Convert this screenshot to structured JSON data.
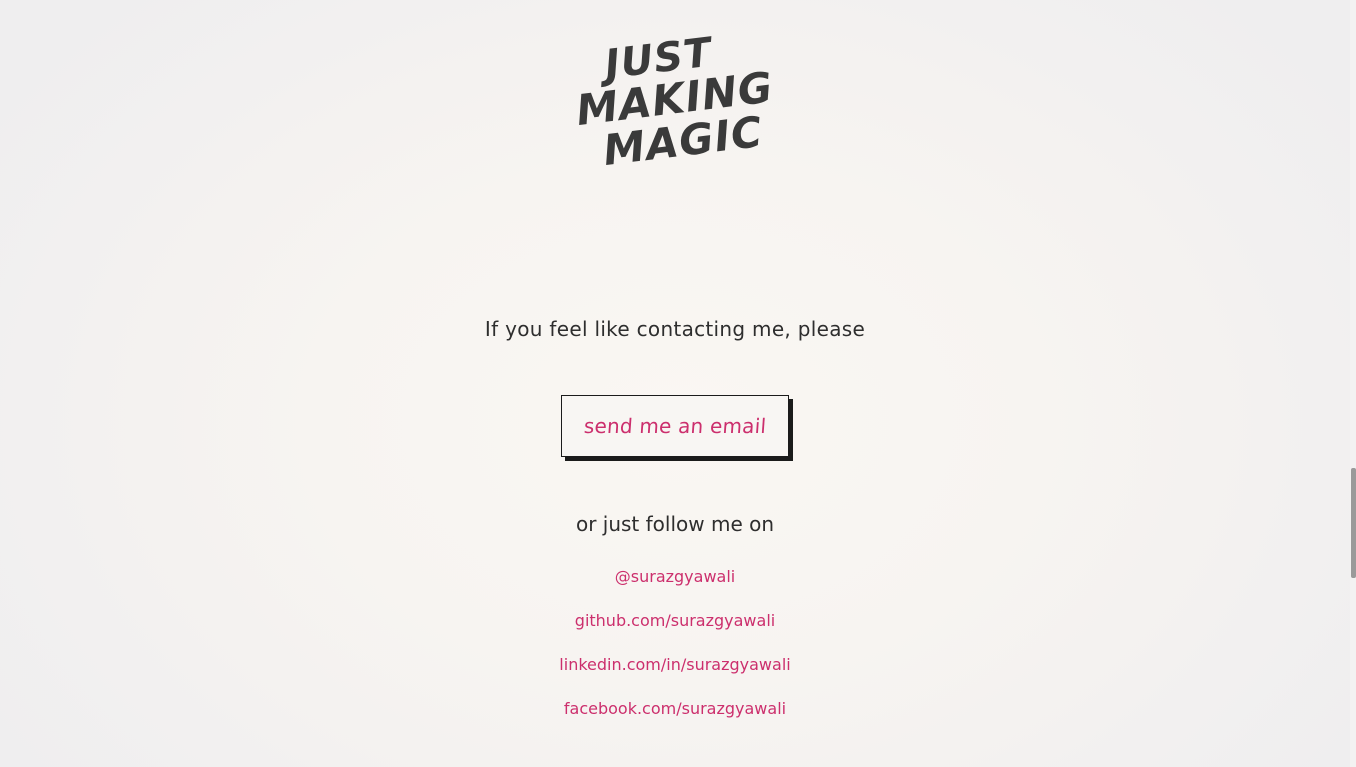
{
  "logo": {
    "line1": "JUST",
    "line2": "MAKING",
    "line3": "MAGIC",
    "color": "#3a3a3a"
  },
  "contact": {
    "intro": "If you feel like contacting me, please",
    "email_button_label": "send me an email",
    "follow_text": "or just follow me on"
  },
  "social_links": [
    {
      "label": "@surazgyawali",
      "icon": "twitter-icon"
    },
    {
      "label": "github.com/surazgyawali",
      "icon": "github-icon"
    },
    {
      "label": "linkedin.com/in/surazgyawali",
      "icon": "linkedin-icon"
    },
    {
      "label": "facebook.com/surazgyawali",
      "icon": "facebook-icon"
    }
  ],
  "colors": {
    "accent": "#cc2f6d",
    "text": "#2e2e2e",
    "button_shadow": "#1b1b1b"
  }
}
